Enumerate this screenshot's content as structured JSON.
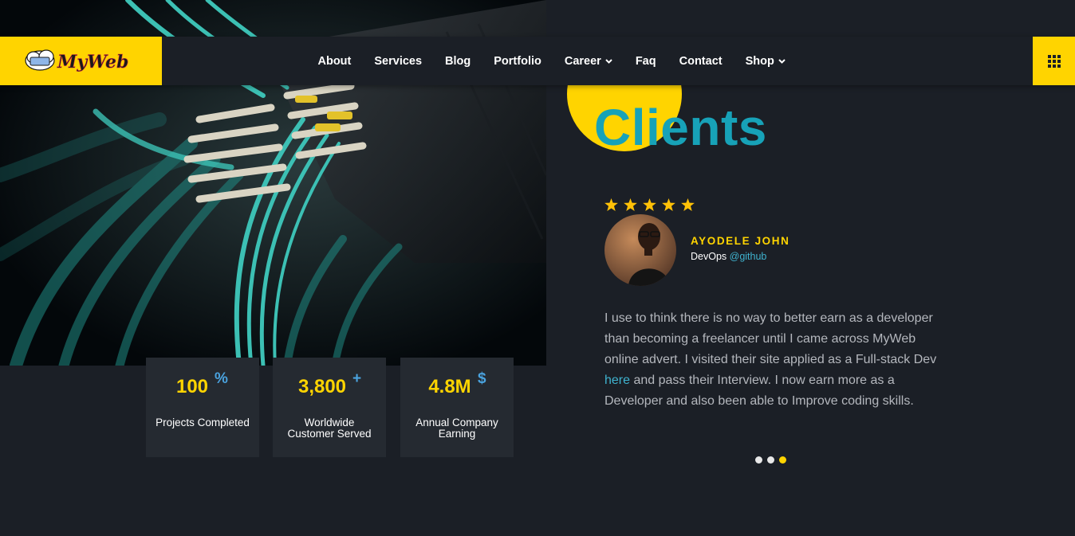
{
  "brand": {
    "logo_text": "MyWeb"
  },
  "nav": {
    "items": [
      {
        "label": "About"
      },
      {
        "label": "Services"
      },
      {
        "label": "Blog"
      },
      {
        "label": "Portfolio"
      },
      {
        "label": "Career",
        "dropdown": true
      },
      {
        "label": "Faq"
      },
      {
        "label": "Contact"
      },
      {
        "label": "Shop",
        "dropdown": true
      }
    ],
    "menu_icon": "grid-menu-icon"
  },
  "clients": {
    "title": "Clients",
    "rating": 5,
    "name": "AYODELE JOHN",
    "role": "DevOps",
    "handle": "@github",
    "testimonial_part1": "I use to think there is no way to better earn as a developer than becoming a freelancer until I came across MyWeb online advert. I visited their site applied as a Full-stack Dev ",
    "testimonial_link": "here",
    "testimonial_part2": " and pass their Interview. I now earn more as a Developer and also been able to Improve coding skills.",
    "carousel": {
      "count": 3,
      "active": 3
    }
  },
  "stats": [
    {
      "value": "100",
      "suffix": "%",
      "label": "Projects Completed"
    },
    {
      "value": "3,800",
      "suffix": "+",
      "label": "Worldwide Customer Served"
    },
    {
      "value": "4.8M",
      "suffix": "$",
      "label": "Annual Company Earning"
    }
  ],
  "colors": {
    "accent": "#ffd400",
    "teal": "#17a2b8",
    "background": "#1b1f26",
    "card": "#252a31",
    "link": "#3fb3cf"
  }
}
